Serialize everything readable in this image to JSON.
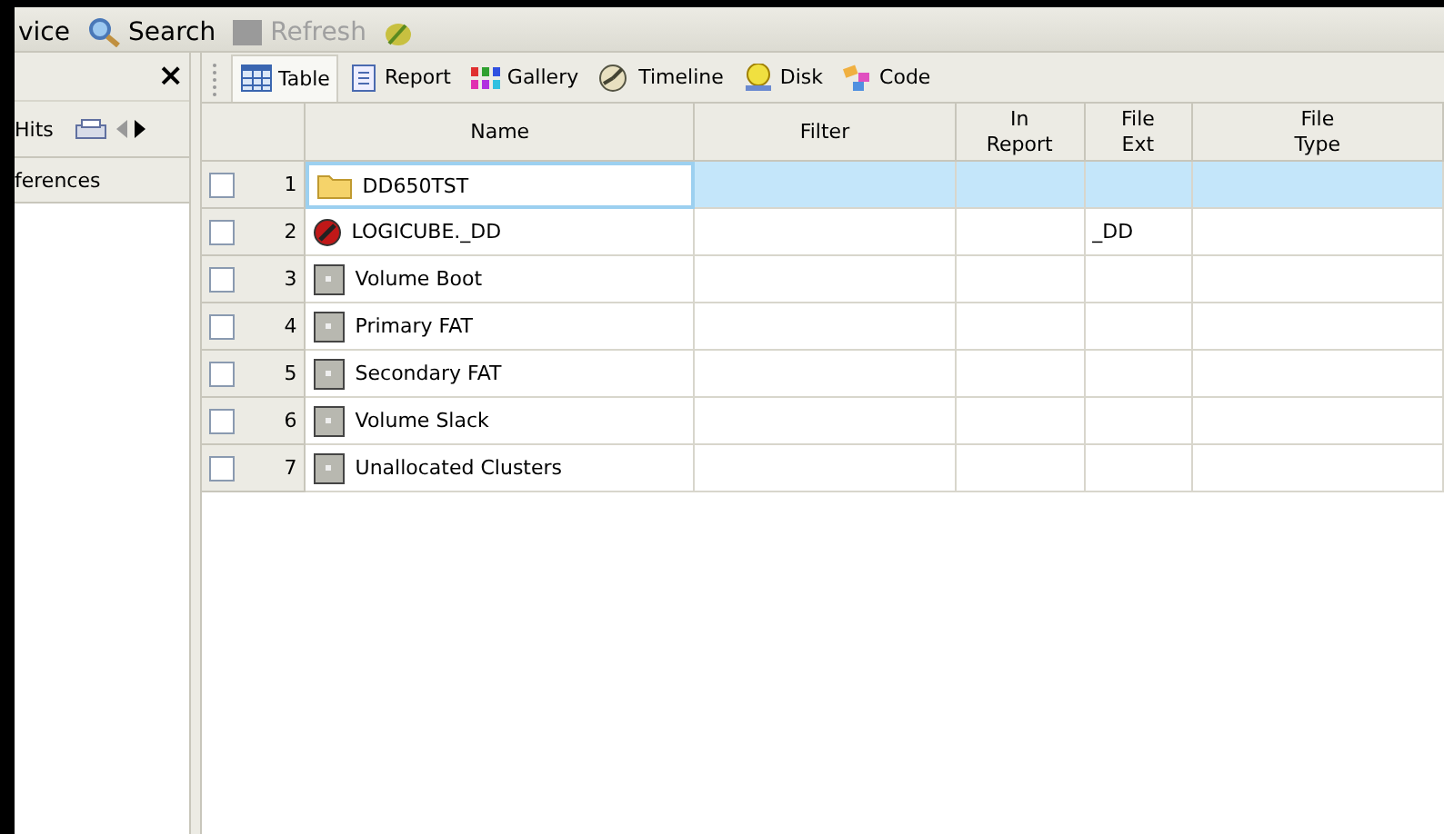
{
  "toolbar": [
    {
      "label": "vice",
      "kind": "text",
      "disabled": false
    },
    {
      "label": "Search",
      "kind": "search",
      "disabled": false
    },
    {
      "label": "Refresh",
      "kind": "refresh",
      "disabled": true
    },
    {
      "kind": "clip",
      "disabled": false
    }
  ],
  "left_panel": {
    "close": "×",
    "tabs": [
      {
        "label": "Hits",
        "selected": false
      }
    ],
    "items": [
      {
        "label": "ferences",
        "selected": true
      }
    ]
  },
  "view_tabs": [
    {
      "label": "Table",
      "kind": "table",
      "selected": true
    },
    {
      "label": "Report",
      "kind": "report",
      "selected": false
    },
    {
      "label": "Gallery",
      "kind": "gallery",
      "selected": false
    },
    {
      "label": "Timeline",
      "kind": "timeline",
      "selected": false
    },
    {
      "label": "Disk",
      "kind": "disk",
      "selected": false
    },
    {
      "label": "Code",
      "kind": "code",
      "selected": false
    }
  ],
  "table": {
    "columns": [
      {
        "label": "Name"
      },
      {
        "label": "Filter"
      },
      {
        "label": "In Report"
      },
      {
        "label": "File Ext"
      },
      {
        "label": "File Type"
      }
    ],
    "rows": [
      {
        "num": "1",
        "kind": "folder",
        "name": "DD650TST",
        "checked": false,
        "selected": true
      },
      {
        "num": "2",
        "kind": "deleted",
        "name": "LOGICUBE._DD",
        "ext": "_DD",
        "checked": false,
        "selected": false
      },
      {
        "num": "3",
        "kind": "volume",
        "name": "Volume Boot",
        "checked": false,
        "selected": false
      },
      {
        "num": "4",
        "kind": "volume",
        "name": "Primary FAT",
        "checked": false,
        "selected": false
      },
      {
        "num": "5",
        "kind": "volume",
        "name": "Secondary FAT",
        "checked": false,
        "selected": false
      },
      {
        "num": "6",
        "kind": "volume",
        "name": "Volume Slack",
        "checked": false,
        "selected": false
      },
      {
        "num": "7",
        "kind": "volume",
        "name": "Unallocated Clusters",
        "checked": false,
        "selected": false
      }
    ]
  }
}
